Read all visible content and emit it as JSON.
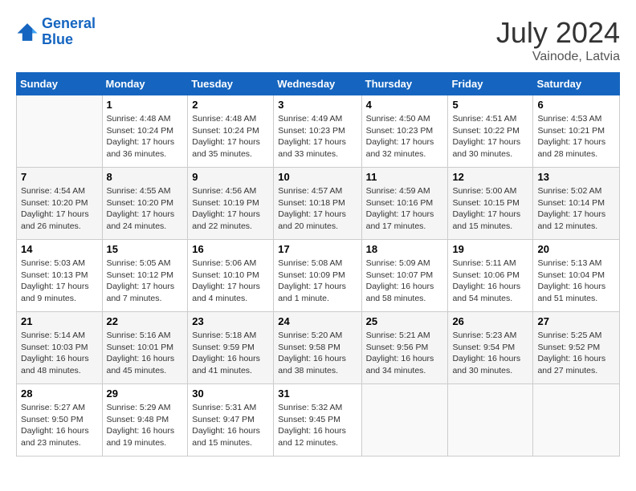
{
  "header": {
    "logo_line1": "General",
    "logo_line2": "Blue",
    "month_year": "July 2024",
    "location": "Vainode, Latvia"
  },
  "columns": [
    "Sunday",
    "Monday",
    "Tuesday",
    "Wednesday",
    "Thursday",
    "Friday",
    "Saturday"
  ],
  "weeks": [
    [
      {
        "day": "",
        "content": ""
      },
      {
        "day": "1",
        "content": "Sunrise: 4:48 AM\nSunset: 10:24 PM\nDaylight: 17 hours\nand 36 minutes."
      },
      {
        "day": "2",
        "content": "Sunrise: 4:48 AM\nSunset: 10:24 PM\nDaylight: 17 hours\nand 35 minutes."
      },
      {
        "day": "3",
        "content": "Sunrise: 4:49 AM\nSunset: 10:23 PM\nDaylight: 17 hours\nand 33 minutes."
      },
      {
        "day": "4",
        "content": "Sunrise: 4:50 AM\nSunset: 10:23 PM\nDaylight: 17 hours\nand 32 minutes."
      },
      {
        "day": "5",
        "content": "Sunrise: 4:51 AM\nSunset: 10:22 PM\nDaylight: 17 hours\nand 30 minutes."
      },
      {
        "day": "6",
        "content": "Sunrise: 4:53 AM\nSunset: 10:21 PM\nDaylight: 17 hours\nand 28 minutes."
      }
    ],
    [
      {
        "day": "7",
        "content": "Sunrise: 4:54 AM\nSunset: 10:20 PM\nDaylight: 17 hours\nand 26 minutes."
      },
      {
        "day": "8",
        "content": "Sunrise: 4:55 AM\nSunset: 10:20 PM\nDaylight: 17 hours\nand 24 minutes."
      },
      {
        "day": "9",
        "content": "Sunrise: 4:56 AM\nSunset: 10:19 PM\nDaylight: 17 hours\nand 22 minutes."
      },
      {
        "day": "10",
        "content": "Sunrise: 4:57 AM\nSunset: 10:18 PM\nDaylight: 17 hours\nand 20 minutes."
      },
      {
        "day": "11",
        "content": "Sunrise: 4:59 AM\nSunset: 10:16 PM\nDaylight: 17 hours\nand 17 minutes."
      },
      {
        "day": "12",
        "content": "Sunrise: 5:00 AM\nSunset: 10:15 PM\nDaylight: 17 hours\nand 15 minutes."
      },
      {
        "day": "13",
        "content": "Sunrise: 5:02 AM\nSunset: 10:14 PM\nDaylight: 17 hours\nand 12 minutes."
      }
    ],
    [
      {
        "day": "14",
        "content": "Sunrise: 5:03 AM\nSunset: 10:13 PM\nDaylight: 17 hours\nand 9 minutes."
      },
      {
        "day": "15",
        "content": "Sunrise: 5:05 AM\nSunset: 10:12 PM\nDaylight: 17 hours\nand 7 minutes."
      },
      {
        "day": "16",
        "content": "Sunrise: 5:06 AM\nSunset: 10:10 PM\nDaylight: 17 hours\nand 4 minutes."
      },
      {
        "day": "17",
        "content": "Sunrise: 5:08 AM\nSunset: 10:09 PM\nDaylight: 17 hours\nand 1 minute."
      },
      {
        "day": "18",
        "content": "Sunrise: 5:09 AM\nSunset: 10:07 PM\nDaylight: 16 hours\nand 58 minutes."
      },
      {
        "day": "19",
        "content": "Sunrise: 5:11 AM\nSunset: 10:06 PM\nDaylight: 16 hours\nand 54 minutes."
      },
      {
        "day": "20",
        "content": "Sunrise: 5:13 AM\nSunset: 10:04 PM\nDaylight: 16 hours\nand 51 minutes."
      }
    ],
    [
      {
        "day": "21",
        "content": "Sunrise: 5:14 AM\nSunset: 10:03 PM\nDaylight: 16 hours\nand 48 minutes."
      },
      {
        "day": "22",
        "content": "Sunrise: 5:16 AM\nSunset: 10:01 PM\nDaylight: 16 hours\nand 45 minutes."
      },
      {
        "day": "23",
        "content": "Sunrise: 5:18 AM\nSunset: 9:59 PM\nDaylight: 16 hours\nand 41 minutes."
      },
      {
        "day": "24",
        "content": "Sunrise: 5:20 AM\nSunset: 9:58 PM\nDaylight: 16 hours\nand 38 minutes."
      },
      {
        "day": "25",
        "content": "Sunrise: 5:21 AM\nSunset: 9:56 PM\nDaylight: 16 hours\nand 34 minutes."
      },
      {
        "day": "26",
        "content": "Sunrise: 5:23 AM\nSunset: 9:54 PM\nDaylight: 16 hours\nand 30 minutes."
      },
      {
        "day": "27",
        "content": "Sunrise: 5:25 AM\nSunset: 9:52 PM\nDaylight: 16 hours\nand 27 minutes."
      }
    ],
    [
      {
        "day": "28",
        "content": "Sunrise: 5:27 AM\nSunset: 9:50 PM\nDaylight: 16 hours\nand 23 minutes."
      },
      {
        "day": "29",
        "content": "Sunrise: 5:29 AM\nSunset: 9:48 PM\nDaylight: 16 hours\nand 19 minutes."
      },
      {
        "day": "30",
        "content": "Sunrise: 5:31 AM\nSunset: 9:47 PM\nDaylight: 16 hours\nand 15 minutes."
      },
      {
        "day": "31",
        "content": "Sunrise: 5:32 AM\nSunset: 9:45 PM\nDaylight: 16 hours\nand 12 minutes."
      },
      {
        "day": "",
        "content": ""
      },
      {
        "day": "",
        "content": ""
      },
      {
        "day": "",
        "content": ""
      }
    ]
  ]
}
